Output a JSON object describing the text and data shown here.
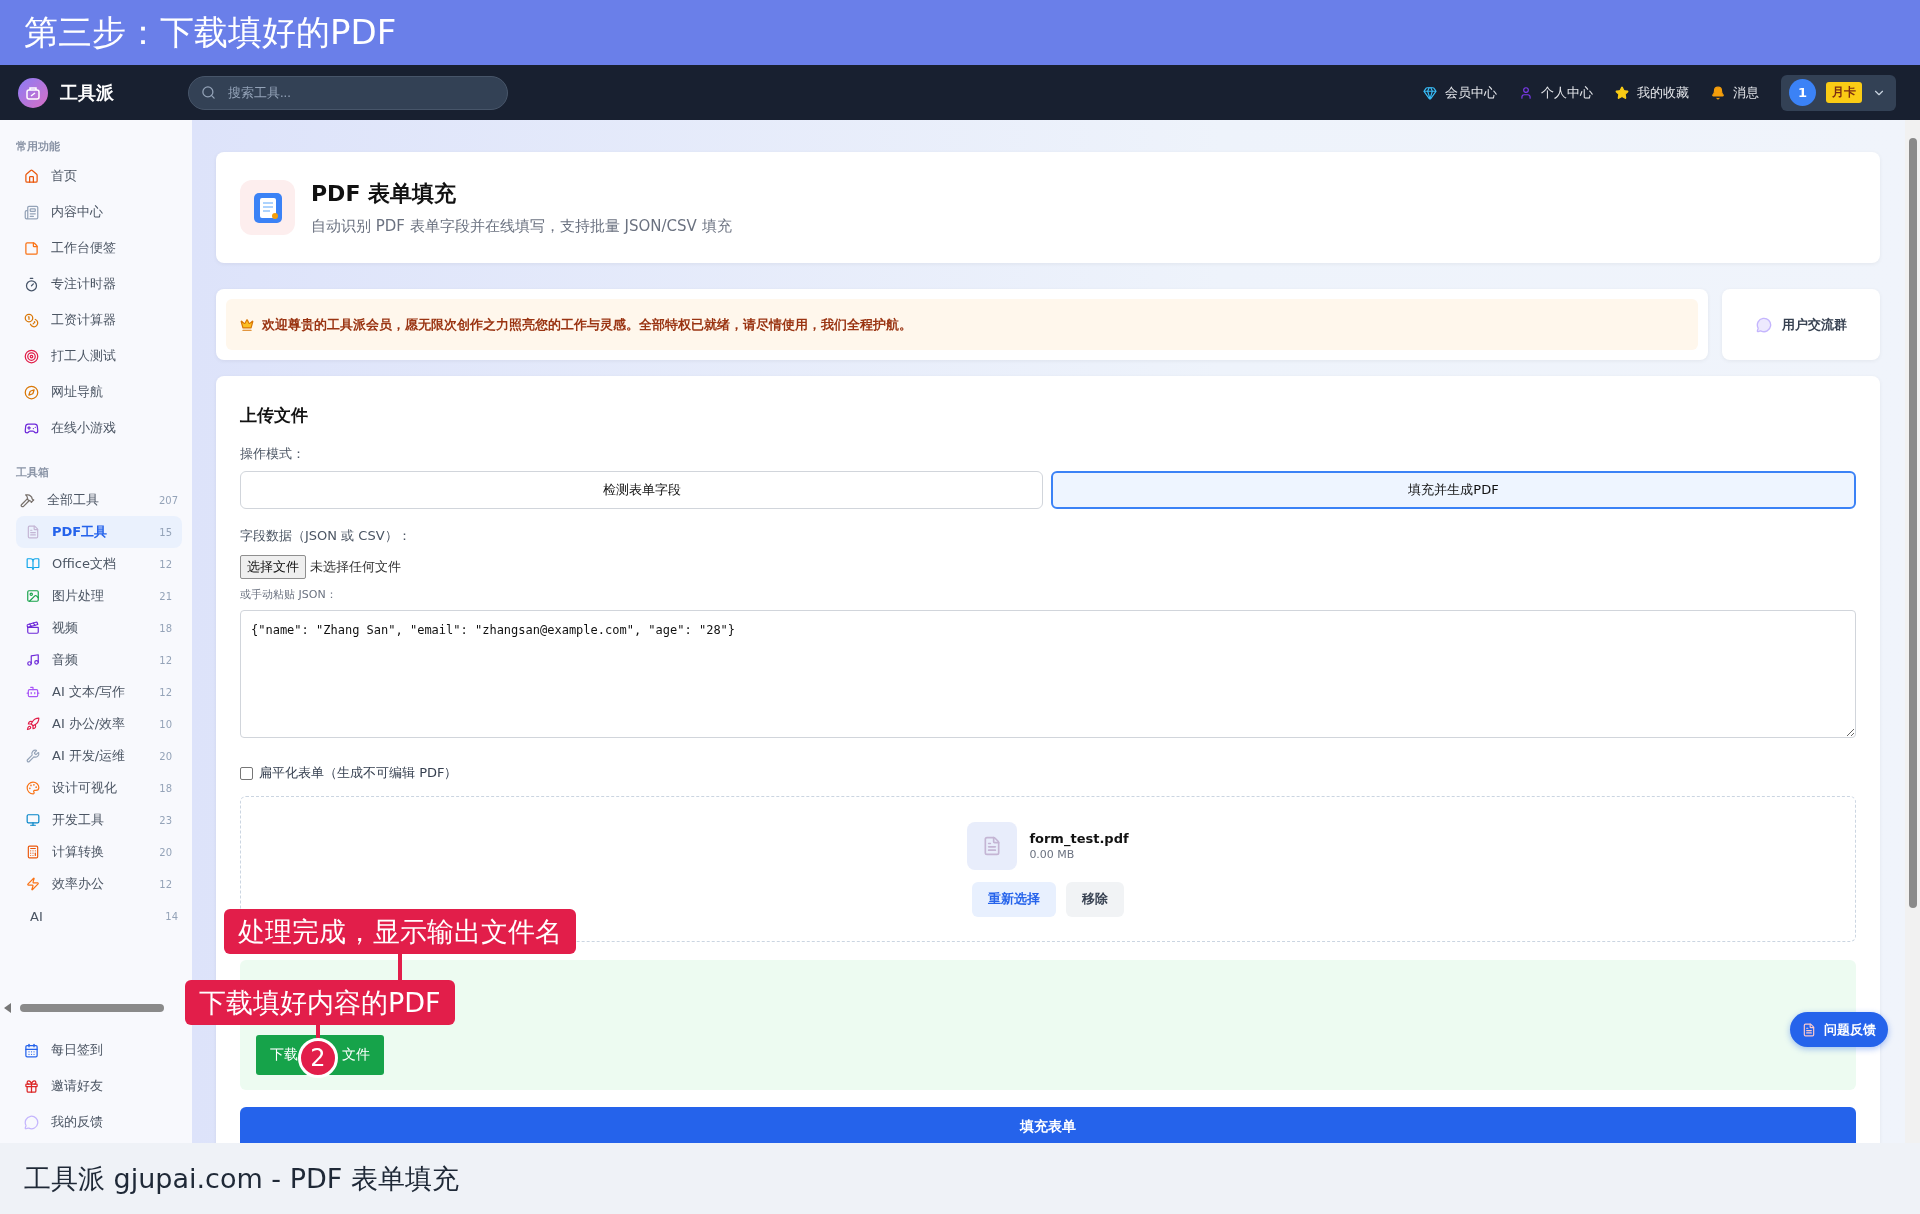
{
  "banner": {
    "title": "第三步：下载填好的PDF"
  },
  "nav": {
    "brand": "工具派",
    "search_placeholder": "搜索工具...",
    "links": [
      {
        "label": "会员中心"
      },
      {
        "label": "个人中心"
      },
      {
        "label": "我的收藏"
      },
      {
        "label": "消息"
      }
    ],
    "user": {
      "avatar": "1",
      "badge": "月卡"
    }
  },
  "sidebar": {
    "common_title": "常用功能",
    "common": [
      {
        "label": "首页",
        "selected": false
      },
      {
        "label": "内容中心",
        "selected": false
      },
      {
        "label": "工作台便签",
        "selected": false
      },
      {
        "label": "专注计时器",
        "selected": false
      },
      {
        "label": "工资计算器",
        "selected": false
      },
      {
        "label": "打工人测试",
        "selected": false
      },
      {
        "label": "网址导航",
        "selected": false
      },
      {
        "label": "在线小游戏",
        "selected": false
      }
    ],
    "toolbox_title": "工具箱",
    "tools": [
      {
        "label": "全部工具",
        "count": "207",
        "selected": false,
        "children": [
          {
            "label": "PDF工具",
            "count": "15",
            "selected": true
          },
          {
            "label": "Office文档",
            "count": "12",
            "selected": false
          },
          {
            "label": "图片处理",
            "count": "21",
            "selected": false
          },
          {
            "label": "视频",
            "count": "18",
            "selected": false
          },
          {
            "label": "音频",
            "count": "12",
            "selected": false
          },
          {
            "label": "AI 文本/写作",
            "count": "12",
            "selected": false
          },
          {
            "label": "AI 办公/效率",
            "count": "10",
            "selected": false
          },
          {
            "label": "AI 开发/运维",
            "count": "20",
            "selected": false
          },
          {
            "label": "设计可视化",
            "count": "18",
            "selected": false
          },
          {
            "label": "开发工具",
            "count": "23",
            "selected": false
          },
          {
            "label": "计算转换",
            "count": "20",
            "selected": false
          },
          {
            "label": "效率办公",
            "count": "12",
            "selected": false
          }
        ]
      },
      {
        "label": "AI",
        "count": "14",
        "selected": false
      }
    ],
    "bottom": [
      {
        "label": "每日签到",
        "selected": false
      },
      {
        "label": "邀请好友",
        "selected": false
      },
      {
        "label": "我的反馈",
        "selected": false
      }
    ]
  },
  "header": {
    "title": "PDF 表单填充",
    "subtitle": "自动识别 PDF 表单字段并在线填写，支持批量 JSON/CSV 填充"
  },
  "notice": {
    "text": "欢迎尊贵的工具派会员，愿无限次创作之力照亮您的工作与灵感。全部特权已就绪，请尽情使用，我们全程护航。",
    "group_button": "用户交流群"
  },
  "upload": {
    "title": "上传文件",
    "mode_label": "操作模式：",
    "modes": [
      {
        "label": "检测表单字段",
        "selected": false
      },
      {
        "label": "填充并生成PDF",
        "selected": true
      }
    ],
    "data_label": "字段数据（JSON 或 CSV）：",
    "choose_button": "选择文件",
    "no_file": "未选择任何文件",
    "paste_label": "或手动粘贴 JSON：",
    "json_value": "{\"name\": \"Zhang San\", \"email\": \"zhangsan@example.com\", \"age\": \"28\"}",
    "flatten": {
      "label": "扁平化表单（生成不可编辑 PDF）",
      "checked": false
    },
    "file": {
      "name": "form_test.pdf",
      "size": "0.00 MB",
      "reselect": "重新选择",
      "remove": "移除"
    },
    "download_parts": [
      "下载",
      "文件"
    ],
    "submit": "填充表单"
  },
  "feedback": "问题反馈",
  "annotations": [
    {
      "text": "处理完成，显示输出文件名"
    },
    {
      "text": "下载填好内容的PDF",
      "step": "2"
    }
  ],
  "caption": "工具派 gjupai.com - PDF 表单填充"
}
